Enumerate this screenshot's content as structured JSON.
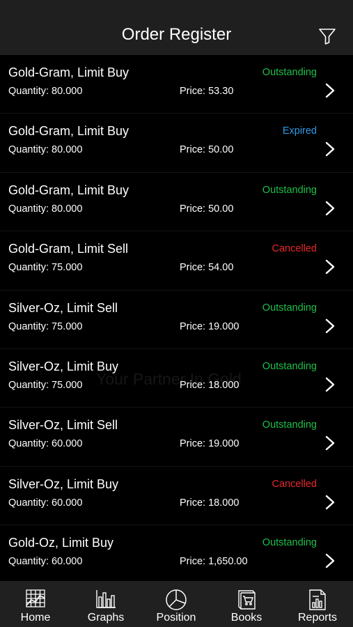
{
  "header": {
    "title": "Order Register",
    "filter_icon": "filter-icon"
  },
  "watermark": {
    "tagline": "Your Partner In Gold"
  },
  "orders": [
    {
      "title": "Gold-Gram, Limit Buy",
      "status": "Outstanding",
      "status_color": "#1fbf4a",
      "quantity": "Quantity: 80.000",
      "price": "Price: 53.30"
    },
    {
      "title": "Gold-Gram, Limit Buy",
      "status": "Expired",
      "status_color": "#2e9be8",
      "quantity": "Quantity: 80.000",
      "price": "Price: 50.00"
    },
    {
      "title": "Gold-Gram, Limit Buy",
      "status": "Outstanding",
      "status_color": "#1fbf4a",
      "quantity": "Quantity: 80.000",
      "price": "Price: 50.00"
    },
    {
      "title": "Gold-Gram, Limit Sell",
      "status": "Cancelled",
      "status_color": "#e8282b",
      "quantity": "Quantity: 75.000",
      "price": "Price: 54.00"
    },
    {
      "title": "Silver-Oz, Limit Sell",
      "status": "Outstanding",
      "status_color": "#1fbf4a",
      "quantity": "Quantity: 75.000",
      "price": "Price: 19.000"
    },
    {
      "title": "Silver-Oz, Limit Buy",
      "status": "Outstanding",
      "status_color": "#1fbf4a",
      "quantity": "Quantity: 75.000",
      "price": "Price: 18.000"
    },
    {
      "title": "Silver-Oz, Limit Sell",
      "status": "Outstanding",
      "status_color": "#1fbf4a",
      "quantity": "Quantity: 60.000",
      "price": "Price: 19.000"
    },
    {
      "title": "Silver-Oz, Limit Buy",
      "status": "Cancelled",
      "status_color": "#e8282b",
      "quantity": "Quantity: 60.000",
      "price": "Price: 18.000"
    },
    {
      "title": "Gold-Oz, Limit Buy",
      "status": "Outstanding",
      "status_color": "#1fbf4a",
      "quantity": "Quantity: 60.000",
      "price": "Price: 1,650.00"
    }
  ],
  "tabs": [
    {
      "label": "Home",
      "icon": "grid-chart-icon"
    },
    {
      "label": "Graphs",
      "icon": "bar-chart-icon"
    },
    {
      "label": "Position",
      "icon": "pie-chart-icon"
    },
    {
      "label": "Books",
      "icon": "cart-book-icon"
    },
    {
      "label": "Reports",
      "icon": "report-icon"
    }
  ]
}
